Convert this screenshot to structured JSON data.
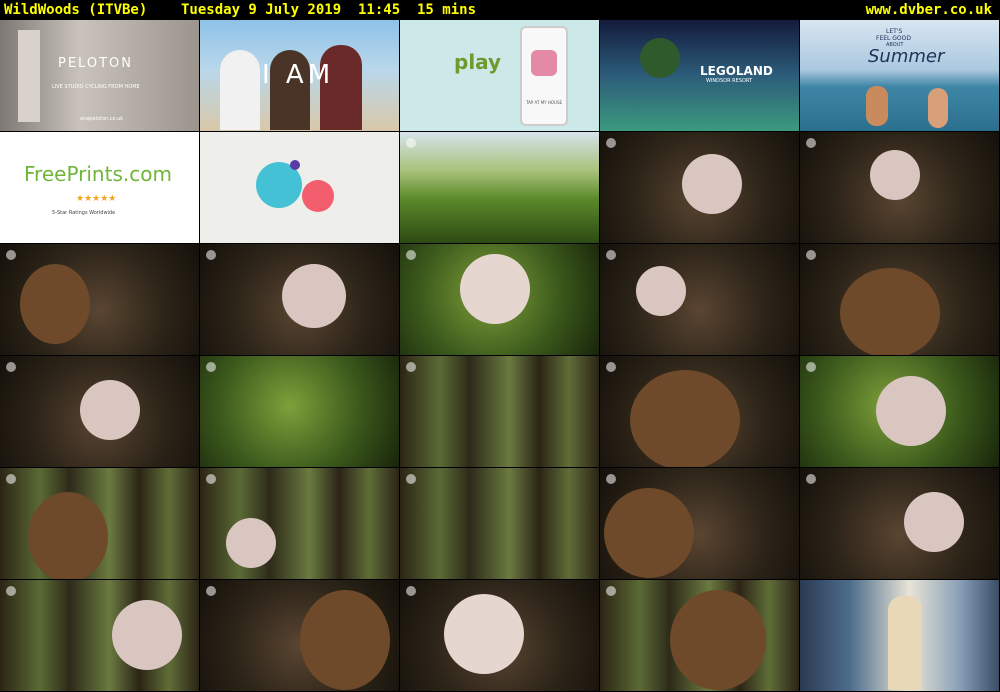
{
  "header": {
    "left": "WildWoods (ITVBe)    Tuesday 9 July 2019  11:45  15 mins",
    "right": "www.dvber.co.uk"
  },
  "colors": {
    "header_text": "#ffff00",
    "background": "#000000"
  },
  "thumbnails": {
    "peloton": {
      "brand": "PELOTON",
      "tagline": "LIVE STUDIO CYCLING FROM HOME",
      "url": "onepeloton.co.uk"
    },
    "iam": {
      "brand": "I AM"
    },
    "play": {
      "brand": "play",
      "cta": "TAP AT MY HOUSE"
    },
    "lego": {
      "brand": "LEGOLAND",
      "sub": "WINDSOR RESORT"
    },
    "summer": {
      "line1": "LET'S",
      "line2": "FEEL GOOD",
      "line3": "ABOUT",
      "line4": "Summer"
    },
    "freeprints": {
      "brand": "FreePrints.com",
      "stars": "★★★★★",
      "rating": "5-Star Ratings Worldwide"
    }
  }
}
